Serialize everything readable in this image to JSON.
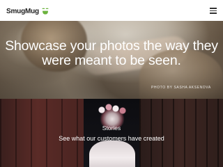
{
  "header": {
    "logo_text": "SmugMug",
    "logo_icon": "smug-face-icon",
    "menu_icon": "hamburger-menu-icon"
  },
  "hero": {
    "headline": "Showcase your photos the way they were meant to be seen.",
    "photo_credit": "PHOTO BY SASHA AKSENOVA"
  },
  "stories": {
    "label": "Stories",
    "tagline": "See what our customers have created"
  },
  "colors": {
    "header_bg": "#ffffff",
    "brand_green": "#6cb33f",
    "text_light": "#ffffff"
  }
}
